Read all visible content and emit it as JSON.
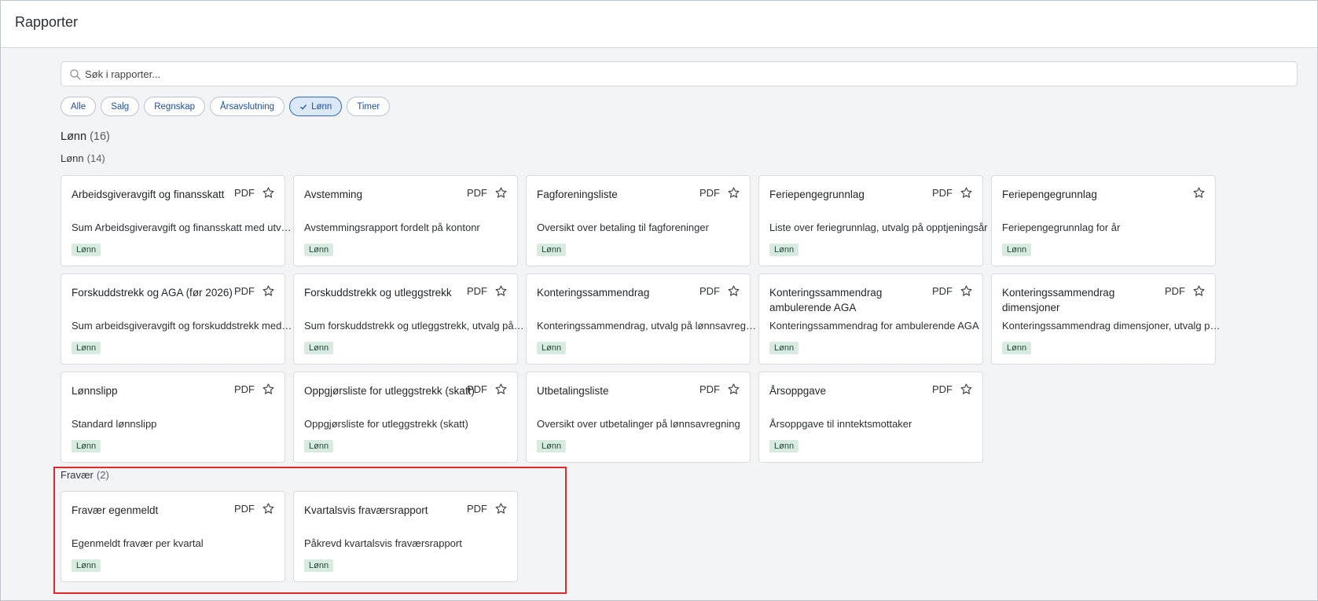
{
  "header": {
    "title": "Rapporter"
  },
  "search": {
    "placeholder": "Søk i rapporter..."
  },
  "filters": [
    {
      "label": "Alle",
      "active": false
    },
    {
      "label": "Salg",
      "active": false
    },
    {
      "label": "Regnskap",
      "active": false
    },
    {
      "label": "Årsavslutning",
      "active": false
    },
    {
      "label": "Lønn",
      "active": true
    },
    {
      "label": "Timer",
      "active": false
    }
  ],
  "section": {
    "title": "Lønn",
    "count": "(16)"
  },
  "groups": [
    {
      "title": "Lønn",
      "count": "(14)",
      "cards": [
        {
          "title": "Arbeidsgiveravgift og finansskatt",
          "format": "PDF",
          "desc": "Sum Arbeidsgiveravgift og finansskatt med utvalg på kommune",
          "tag": "Lønn"
        },
        {
          "title": "Avstemming",
          "format": "PDF",
          "desc": "Avstemmingsrapport fordelt på kontonr",
          "tag": "Lønn"
        },
        {
          "title": "Fagforeningsliste",
          "format": "PDF",
          "desc": "Oversikt over betaling til fagforeninger",
          "tag": "Lønn"
        },
        {
          "title": "Feriepengegrunnlag",
          "format": "PDF",
          "desc": "Liste over feriegrunnlag, utvalg på opptjeningsår",
          "tag": "Lønn"
        },
        {
          "title": "Feriepengegrunnlag",
          "format": "",
          "desc": "Feriepengegrunnlag for år",
          "tag": "Lønn"
        },
        {
          "title": "Forskuddstrekk og AGA (før 2026)",
          "format": "PDF",
          "desc": "Sum arbeidsgiveravgift og forskuddstrekk med utvalg",
          "tag": "Lønn"
        },
        {
          "title": "Forskuddstrekk og utleggstrekk",
          "format": "PDF",
          "desc": "Sum forskuddstrekk og utleggstrekk, utvalg på periode",
          "tag": "Lønn"
        },
        {
          "title": "Konteringssammendrag",
          "format": "PDF",
          "desc": "Konteringssammendrag, utvalg på lønnsavregning",
          "tag": "Lønn"
        },
        {
          "title": "Konteringssammendrag ambulerende AGA",
          "format": "PDF",
          "desc": "Konteringssammendrag for ambulerende AGA",
          "tag": "Lønn"
        },
        {
          "title": "Konteringssammendrag dimensjoner",
          "format": "PDF",
          "desc": "Konteringssammendrag dimensjoner, utvalg på lønnsavregning",
          "tag": "Lønn"
        },
        {
          "title": "Lønnslipp",
          "format": "PDF",
          "desc": "Standard lønnslipp",
          "tag": "Lønn"
        },
        {
          "title": "Oppgjørsliste for utleggstrekk (skatt)",
          "format": "PDF",
          "desc": "Oppgjørsliste for utleggstrekk (skatt)",
          "tag": "Lønn"
        },
        {
          "title": "Utbetalingsliste",
          "format": "PDF",
          "desc": "Oversikt over utbetalinger på lønnsavregning",
          "tag": "Lønn"
        },
        {
          "title": "Årsoppgave",
          "format": "PDF",
          "desc": "Årsoppgave til inntektsmottaker",
          "tag": "Lønn"
        }
      ]
    },
    {
      "title": "Fravær",
      "count": "(2)",
      "cards": [
        {
          "title": "Fravær egenmeldt",
          "format": "PDF",
          "desc": "Egenmeldt fravær per kvartal",
          "tag": "Lønn"
        },
        {
          "title": "Kvartalsvis fraværsrapport",
          "format": "PDF",
          "desc": "Påkrevd kvartalsvis fraværsrapport",
          "tag": "Lønn"
        }
      ]
    }
  ]
}
